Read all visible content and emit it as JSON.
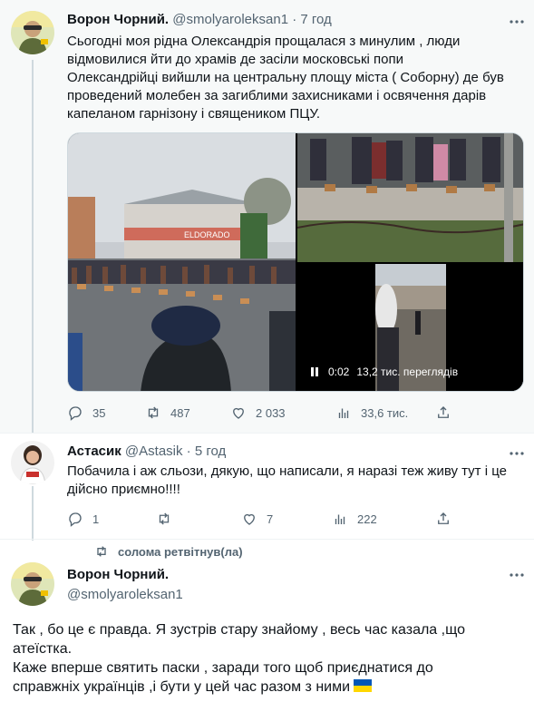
{
  "tweet1": {
    "name": "Ворон Чорний.",
    "handle": "@smolyaroleksan1",
    "separator": "·",
    "time": "7 год",
    "text_lines": [
      "Сьогодні моя рідна Олександрія прощалася з минулим , люди",
      "відмовилися йти до храмів де засіли московські попи",
      "Олександрійці вийшли на центральну площу міста ( Соборну) де був",
      "проведений молебен за загиблими захисниками і освячення дарів",
      "капеланом гарнізону і священиком ПЦУ."
    ],
    "media": {
      "sign_text": "ELDORADO",
      "video_time": "0:02",
      "video_views": "13,2 тис. переглядів"
    },
    "actions": {
      "replies": "35",
      "retweets": "487",
      "likes": "2 033",
      "views": "33,6 тис."
    }
  },
  "tweet2": {
    "name": "Астасик",
    "handle": "@Astasik",
    "separator": "·",
    "time": "5 год",
    "text_lines": [
      "Побачила і аж сльози, дякую, що написали, я наразі теж живу тут і це",
      "дійсно приємно!!!!"
    ],
    "actions": {
      "replies": "1",
      "retweets": "",
      "likes": "7",
      "views": "222"
    }
  },
  "retweet_context": {
    "text": "солома ретвітнув(ла)"
  },
  "tweet3": {
    "name": "Ворон Чорний.",
    "handle": "@smolyaroleksan1",
    "text_lines": [
      "Так , бо це є правда. Я зустрів стару знайому , весь час казала ,що",
      "атеїстка.",
      "Каже вперше святить паски ,   заради того щоб приєднатися до",
      "справжніх українців ,і бути у цей час разом з ними"
    ]
  },
  "colors": {
    "primary_text": "#0f1419",
    "secondary_text": "#536471",
    "selected_bg": "#f7f9f9",
    "border": "#cfd9de",
    "flag_blue": "#0057b7",
    "flag_yellow": "#ffd700"
  },
  "icons": [
    "more-icon",
    "reply-icon",
    "retweet-icon",
    "like-icon",
    "views-icon",
    "share-icon",
    "pause-icon"
  ]
}
